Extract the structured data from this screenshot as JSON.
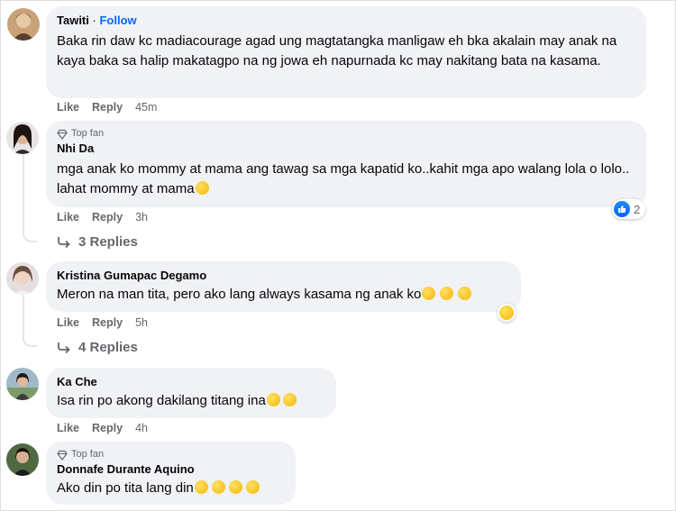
{
  "comments": [
    {
      "author": "Tawiti",
      "separator": "·",
      "follow_label": "Follow",
      "text": "Baka rin daw kc madiacourage agad ung magtatangka manligaw eh bka akalain may anak na kaya baka sa halip makatagpo na ng jowa eh napurnada kc may nakitang bata na kasama.",
      "like_label": "Like",
      "reply_label": "Reply",
      "time": "45m"
    },
    {
      "badge": "Top fan",
      "author": "Nhi Da",
      "text": "mga anak ko mommy at mama ang tawag sa mga kapatid ko..kahit mga apo walang lola o lolo.. lahat mommy at mama",
      "like_label": "Like",
      "reply_label": "Reply",
      "time": "3h",
      "reaction_count": "2",
      "replies_label": "3 Replies"
    },
    {
      "author": "Kristina Gumapac Degamo",
      "text": "Meron na man tita, pero ako lang always kasama ng anak ko",
      "like_label": "Like",
      "reply_label": "Reply",
      "time": "5h",
      "replies_label": "4 Replies"
    },
    {
      "author": "Ka Che",
      "text": "Isa rin po akong dakilang titang ina",
      "like_label": "Like",
      "reply_label": "Reply",
      "time": "4h"
    },
    {
      "badge": "Top fan",
      "author": "Donnafe Durante Aquino",
      "text": "Ako din po tita lang din"
    }
  ],
  "colors": {
    "bubble": "#f0f2f5",
    "secondary_text": "#65676b",
    "follow_blue": "#0866ff"
  }
}
